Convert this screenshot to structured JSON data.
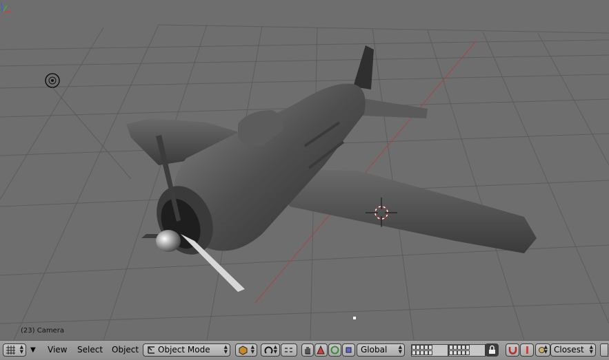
{
  "viewport": {
    "status_text": "(23) Camera"
  },
  "header": {
    "menus": {
      "view": "View",
      "select": "Select",
      "object": "Object"
    },
    "mode": {
      "selected": "Object Mode"
    },
    "orientation": {
      "selected": "Global"
    },
    "snap": {
      "selected": "Closest"
    }
  },
  "icons": {
    "editor_type": "grid-icon",
    "menu_toggle": "triangle-down-icon",
    "mode": "object-mode-icon",
    "shading": "solid-shading-icon",
    "pivot": "pivot-icon",
    "manipulator_hand": "hand-icon",
    "manipulator_translate": "translate-icon",
    "manipulator_rotate": "rotate-icon",
    "manipulator_scale": "scale-icon",
    "lock": "lock-icon",
    "snap_magnet": "magnet-icon",
    "proportional": "proportional-edit-icon",
    "snap_element": "snap-element-icon"
  },
  "colors": {
    "viewport_bg": "#6e6e6e",
    "grid_line": "#5a5a5a",
    "x_axis": "#a04848",
    "header_bg": "#9a9a9a"
  }
}
